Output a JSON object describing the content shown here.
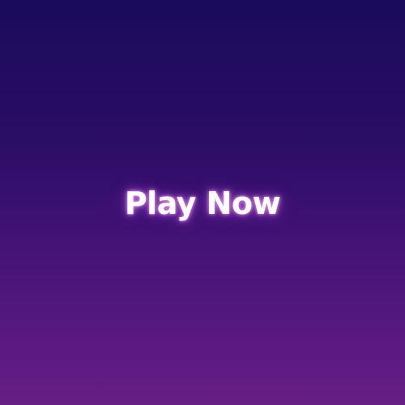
{
  "menu": {
    "play_label": "Play Now"
  },
  "colors": {
    "background_top": "#1a0b5c",
    "background_bottom": "#671e85",
    "label": "#ffffff",
    "glow": "#e078ff"
  }
}
